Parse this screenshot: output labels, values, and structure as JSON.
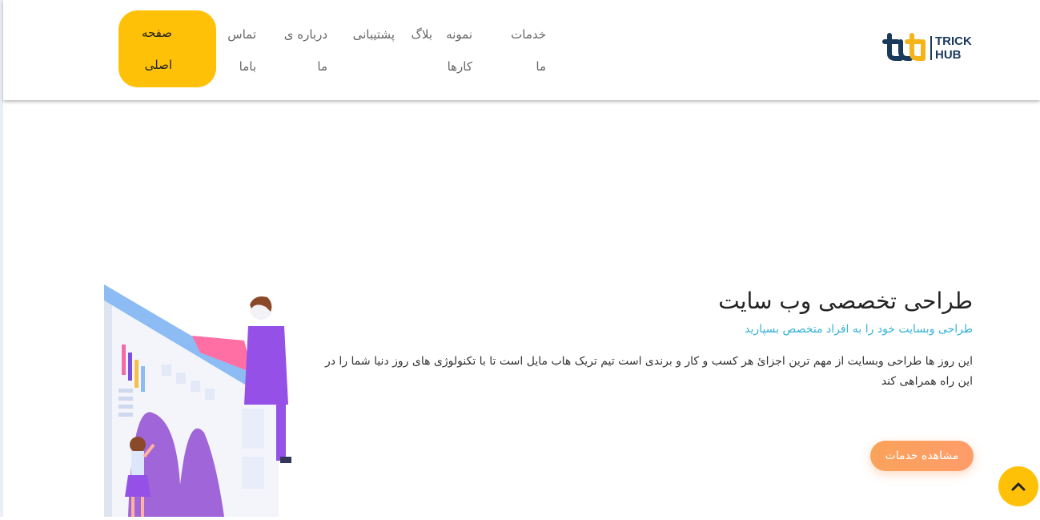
{
  "brand": {
    "line1": "TRICK",
    "line2": "HUB",
    "mark_colors": [
      "#1a3a5c",
      "#f4b41a"
    ]
  },
  "nav": {
    "items": [
      {
        "label": "صفحه اصلی",
        "active": true
      },
      {
        "label": "تماس باما",
        "active": false
      },
      {
        "label": "درباره ی ما",
        "active": false
      },
      {
        "label": "پشتیبانی",
        "active": false
      },
      {
        "label": "بلاگ",
        "active": false
      },
      {
        "label": "نمونه کارها",
        "active": false
      },
      {
        "label": "خدمات ما",
        "active": false
      }
    ]
  },
  "hero": {
    "title": "طراحی تخصصی وب سایت",
    "subtitle": "طراحی وبسایت خود را به افراد متخصص بسپارید",
    "body": "این روز ها طراحی وبسایت از مهم ترین اجزائ هر کسب و کار و برندی است تیم تریک هاب مایل است تا با تکنولوژی های روز دنیا شما را در این راه همراهی کند",
    "cta_label": "مشاهده خدمات"
  },
  "back_to_top": {
    "icon": "chevron-up-icon"
  },
  "colors": {
    "accent": "#ffc107",
    "subtitle": "#35b3d9",
    "cta_gradient": [
      "#f9a35b",
      "#ff9c6a"
    ],
    "brand": "#1a3a5c"
  }
}
